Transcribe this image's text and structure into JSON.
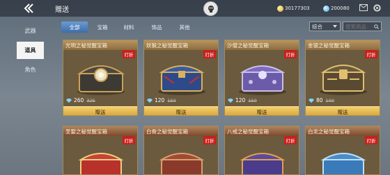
{
  "header": {
    "title": "赠送",
    "coin_amount": "30177303",
    "diamond_amount": "200080"
  },
  "sidebar": {
    "items": [
      {
        "label": "武器"
      },
      {
        "label": "道具"
      },
      {
        "label": "角色"
      }
    ]
  },
  "filters": {
    "tabs": [
      {
        "label": "全部"
      },
      {
        "label": "宝箱"
      },
      {
        "label": "材料"
      },
      {
        "label": "饰品"
      },
      {
        "label": "其他"
      }
    ],
    "sort_value": "综合",
    "search_placeholder": "搜索商品"
  },
  "products": [
    {
      "name": "光明之秘觉醒宝箱",
      "badge": "打折",
      "price": "260",
      "original_price": "325",
      "button": "赠送"
    },
    {
      "name": "妖猴之秘觉醒宝箱",
      "badge": "打折",
      "price": "120",
      "original_price": "150",
      "button": "赠送"
    },
    {
      "name": "沙僧之秘觉醒宝箱",
      "badge": "打折",
      "price": "120",
      "original_price": "150",
      "button": "赠送"
    },
    {
      "name": "金银之秘觉醒宝箱",
      "badge": "打折",
      "price": "80",
      "original_price": "100",
      "button": "赠送"
    },
    {
      "name": "圣婴之秘觉醒宝箱",
      "badge": "打折"
    },
    {
      "name": "白骨之秘觉醒宝箱",
      "badge": "打折"
    },
    {
      "name": "八戒之秘觉醒宝箱",
      "badge": "打折"
    },
    {
      "name": "白龙之秘觉醒宝箱",
      "badge": "打折"
    }
  ],
  "colors": {
    "accent_blue": "#3c6da8",
    "badge_red": "#c8201c",
    "button_gold": "#f4cf6a",
    "sidebar_active": "#f4f4f4"
  },
  "icons": [
    "back-arrow-icon",
    "skull-logo-icon",
    "coin-icon",
    "diamond-icon",
    "mail-icon",
    "gear-icon",
    "search-icon",
    "gem-icon",
    "sort-caret-icon"
  ]
}
